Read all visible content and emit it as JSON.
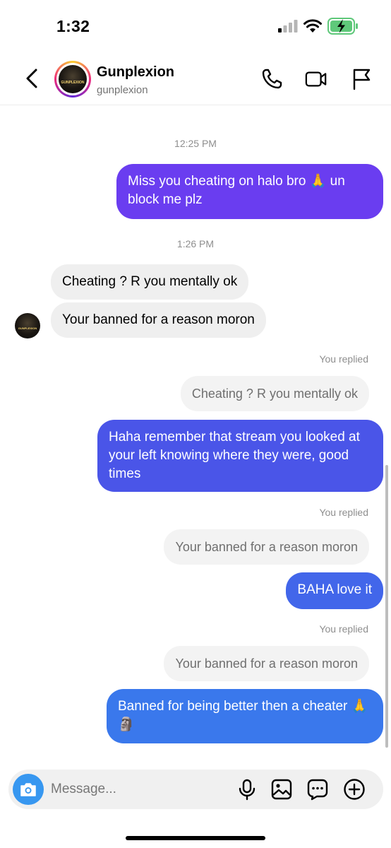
{
  "status_bar": {
    "time": "1:32"
  },
  "header": {
    "contact_name": "Gunplexion",
    "contact_handle": "gunplexion",
    "avatar_text": "GUNPLEXION"
  },
  "messages": {
    "timestamp_1": "12:25 PM",
    "sent_1": "Miss you cheating on halo bro 🙏 un block me plz",
    "timestamp_2": "1:26 PM",
    "recv_1": "Cheating ? R you mentally ok",
    "recv_2": "Your banned for a reason moron",
    "you_replied_1": "You replied",
    "reply_ref_1": "Cheating ? R you mentally ok",
    "sent_2": "Haha remember that stream you looked at your left knowing where they were, good times",
    "you_replied_2": "You replied",
    "reply_ref_2": "Your banned for a reason moron",
    "sent_3": "BAHA love it",
    "you_replied_3": "You replied",
    "reply_ref_3": "Your banned for a reason moron",
    "sent_4": "Banned for being better then a cheater 🙏🗿"
  },
  "composer": {
    "placeholder": "Message..."
  },
  "colors": {
    "sent_purple": "#6a3df0",
    "sent_indigo": "#4a55e8",
    "sent_blue_mid": "#4266ea",
    "sent_blue": "#3a78ec",
    "accent_blue": "#3797f0"
  },
  "icons": {
    "back": "chevron-left-icon",
    "call": "phone-icon",
    "video": "video-camera-icon",
    "flag": "flag-icon",
    "camera": "camera-icon",
    "mic": "microphone-icon",
    "gallery": "image-icon",
    "sticker": "chat-bubble-icon",
    "add": "plus-circle-icon"
  }
}
